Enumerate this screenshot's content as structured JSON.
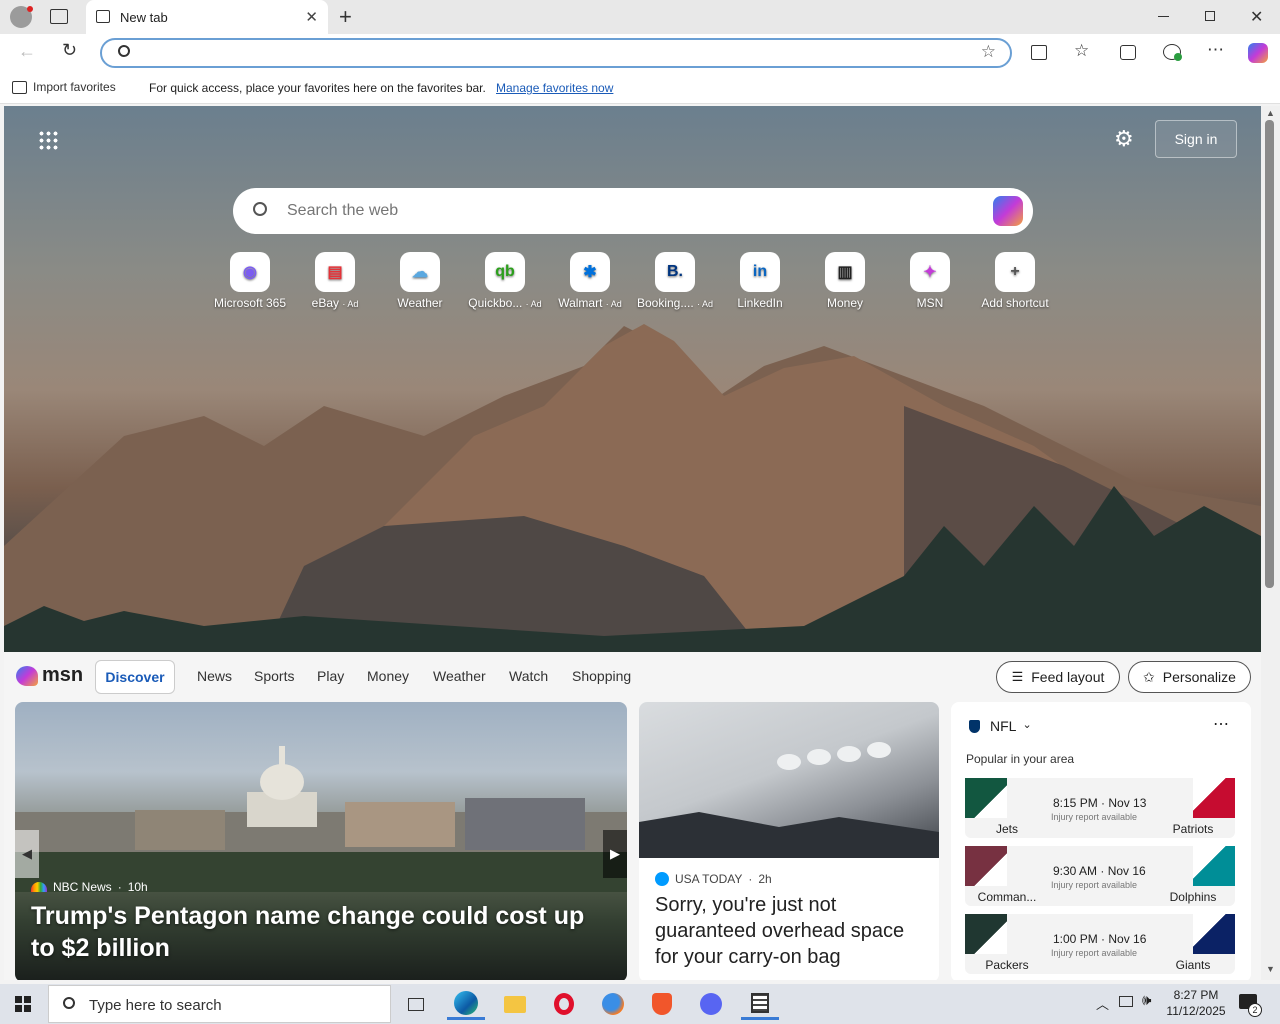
{
  "browser": {
    "tab_title": "New tab",
    "address_value": "",
    "favbar": {
      "import": "Import favorites",
      "message": "For quick access, place your favorites here on the favorites bar.",
      "manage_link": "Manage favorites now"
    }
  },
  "msn": {
    "sign_in": "Sign in",
    "search_placeholder": "Search the web",
    "shortcuts": [
      {
        "label": "Microsoft 365",
        "ad": ""
      },
      {
        "label": "eBay",
        "ad": "· Ad"
      },
      {
        "label": "Weather",
        "ad": ""
      },
      {
        "label": "Quickbo...",
        "ad": "· Ad"
      },
      {
        "label": "Walmart",
        "ad": "· Ad"
      },
      {
        "label": "Booking....",
        "ad": "· Ad"
      },
      {
        "label": "LinkedIn",
        "ad": ""
      },
      {
        "label": "Money",
        "ad": ""
      },
      {
        "label": "MSN",
        "ad": ""
      },
      {
        "label": "Add shortcut",
        "ad": ""
      }
    ],
    "logo": "msn",
    "tabs": [
      "Discover",
      "News",
      "Sports",
      "Play",
      "Money",
      "Weather",
      "Watch",
      "Shopping"
    ],
    "feed_layout": "Feed layout",
    "personalize": "Personalize",
    "lead": {
      "source": "NBC News",
      "age": "10h",
      "headline": "Trump's Pentagon name change could cost up to $2 billion"
    },
    "card2": {
      "source": "USA TODAY",
      "age": "2h",
      "headline": "Sorry, you're just not guaranteed overhead space for your carry-on bag"
    },
    "nfl": {
      "league": "NFL",
      "popular": "Popular in your area",
      "games": [
        {
          "left": "Jets",
          "right": "Patriots",
          "time": "8:15 PM · Nov 13",
          "note": "Injury report available",
          "lc": "#125740",
          "rc": "#c60c30"
        },
        {
          "left": "Comman...",
          "right": "Dolphins",
          "time": "9:30 AM · Nov 16",
          "note": "Injury report available",
          "lc": "#773141",
          "rc": "#008e97"
        },
        {
          "left": "Packers",
          "right": "Giants",
          "time": "1:00 PM · Nov 16",
          "note": "Injury report available",
          "lc": "#203731",
          "rc": "#0b2265"
        }
      ]
    }
  },
  "taskbar": {
    "search_placeholder": "Type here to search",
    "time": "8:27 PM",
    "date": "11/12/2025",
    "notif_count": "2"
  }
}
